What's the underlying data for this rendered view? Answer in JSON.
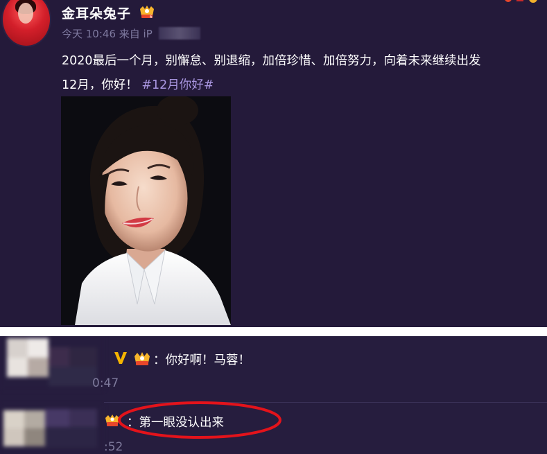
{
  "post": {
    "username": "金耳朵兔子",
    "time": "今天 10:46",
    "source_prefix": "来自 iP",
    "content_line1": "2020最后一个月，别懈怠、别退缩，加倍珍惜、加倍努力，向着未来继续出发",
    "content_line2_text": "12月，你好！",
    "hashtag": "#12月你好#"
  },
  "comments": [
    {
      "text": "：你好啊！马蓉！",
      "time_fragment": "0:47",
      "is_verified": true
    },
    {
      "text": "：第一眼没认出来",
      "time_fragment": ":52",
      "highlighted": true
    }
  ],
  "colors": {
    "post_bg": "#241a3a",
    "comment_bg": "#261d3e",
    "hashtag": "#a996e0",
    "meta": "#7f7aa0",
    "verified_v": "#f5b400",
    "highlight_ring": "#e3131b"
  },
  "icons": {
    "vip_badge": "vip-crown-icon",
    "verified": "verified-v-icon"
  }
}
